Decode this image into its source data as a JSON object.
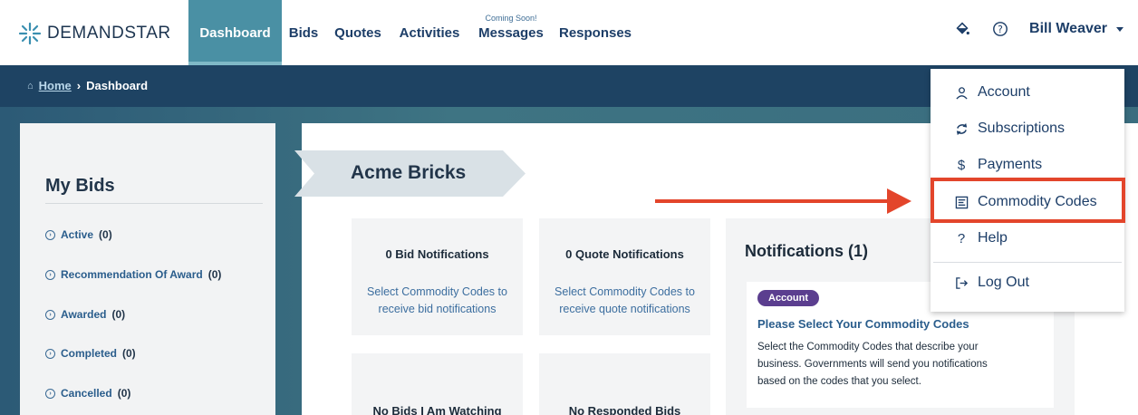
{
  "app": {
    "brand": "DEMANDSTAR"
  },
  "nav": {
    "items": [
      {
        "label": "Dashboard",
        "active": true
      },
      {
        "label": "Bids"
      },
      {
        "label": "Quotes"
      },
      {
        "label": "Activities"
      },
      {
        "label": "Messages",
        "note": "Coming Soon!"
      },
      {
        "label": "Responses"
      }
    ]
  },
  "header": {
    "user_name": "Bill Weaver",
    "icons": [
      "paint-bucket-icon",
      "help-circle-icon",
      "chevron-down-icon"
    ]
  },
  "breadcrumb": {
    "home": "Home",
    "separator": "›",
    "current": "Dashboard"
  },
  "my_bids": {
    "title": "My Bids",
    "items": [
      {
        "label": "Active",
        "count": "(0)"
      },
      {
        "label": "Recommendation Of Award",
        "count": "(0)"
      },
      {
        "label": "Awarded",
        "count": "(0)"
      },
      {
        "label": "Completed",
        "count": "(0)"
      },
      {
        "label": "Cancelled",
        "count": "(0)"
      }
    ]
  },
  "company": {
    "name": "Acme Bricks"
  },
  "cards": [
    {
      "title": "0 Bid Notifications",
      "link_line1": "Select Commodity Codes to",
      "link_line2": "receive bid notifications"
    },
    {
      "title": "0 Quote Notifications",
      "link_line1": "Select Commodity Codes to",
      "link_line2": "receive quote notifications"
    },
    {
      "title": "No Bids I Am Watching"
    },
    {
      "title": "No Responded Bids"
    }
  ],
  "notifications": {
    "title": "Notifications (1)",
    "badge": "Account",
    "heading": "Please Select Your Commodity Codes",
    "body_line1": "Select the Commodity Codes that describe your",
    "body_line2": "business. Governments will send you notifications",
    "body_line3": "based on the codes that you select."
  },
  "user_menu": {
    "items": [
      {
        "label": "Account",
        "icon": "user-icon"
      },
      {
        "label": "Subscriptions",
        "icon": "refresh-icon"
      },
      {
        "label": "Payments",
        "icon": "dollar-icon"
      },
      {
        "label": "Commodity Codes",
        "icon": "list-icon"
      },
      {
        "label": "Help",
        "icon": "question-icon"
      },
      {
        "label": "Log Out",
        "icon": "logout-icon"
      }
    ]
  },
  "colors": {
    "accent_red": "#e3452b",
    "active_tab": "#4a90a4",
    "breadcrumb_bar": "#1e4363",
    "badge": "#5b3e8f"
  }
}
